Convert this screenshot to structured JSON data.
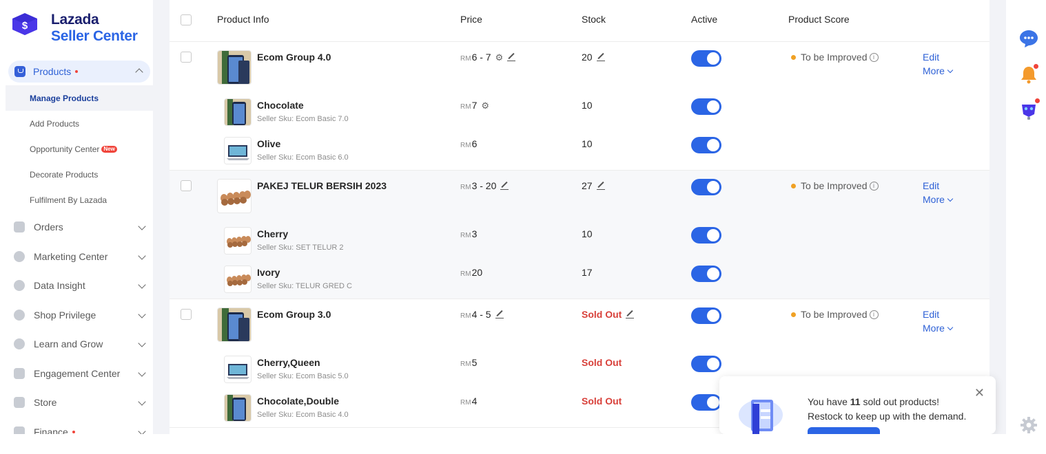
{
  "brand": {
    "line1": "Lazada",
    "line2": "Seller Center"
  },
  "sidebar": {
    "products": {
      "label": "Products"
    },
    "sub_items": [
      "Manage Products",
      "Add Products",
      "Opportunity Center",
      "Decorate Products",
      "Fulfilment By Lazada"
    ],
    "new_badge": "New",
    "items": [
      {
        "label": "Orders"
      },
      {
        "label": "Marketing Center"
      },
      {
        "label": "Data Insight"
      },
      {
        "label": "Shop Privilege"
      },
      {
        "label": "Learn and Grow"
      },
      {
        "label": "Engagement Center"
      },
      {
        "label": "Store"
      },
      {
        "label": "Finance"
      }
    ]
  },
  "table": {
    "headers": {
      "product_info": "Product Info",
      "price": "Price",
      "stock": "Stock",
      "active": "Active",
      "score": "Product Score"
    },
    "currency": "RM",
    "score_label": "To be Improved",
    "edit_label": "Edit",
    "more_label": "More",
    "sold_out_label": "Sold Out",
    "groups": [
      {
        "name": "Ecom Group 4.0",
        "price": "6 - 7",
        "stock": "20",
        "variants": [
          {
            "name": "Chocolate",
            "sku": "Seller Sku: Ecom Basic 7.0",
            "price": "7",
            "stock": "10"
          },
          {
            "name": "Olive",
            "sku": "Seller Sku: Ecom Basic 6.0",
            "price": "6",
            "stock": "10"
          }
        ]
      },
      {
        "name": "PAKEJ TELUR BERSIH 2023",
        "price": "3 - 20",
        "stock": "27",
        "variants": [
          {
            "name": "Cherry",
            "sku": "Seller Sku: SET TELUR 2",
            "price": "3",
            "stock": "10"
          },
          {
            "name": "Ivory",
            "sku": "Seller Sku: TELUR GRED C",
            "price": "20",
            "stock": "17"
          }
        ]
      },
      {
        "name": "Ecom Group 3.0",
        "price": "4 - 5",
        "stock": "Sold Out",
        "variants": [
          {
            "name": "Cherry,Queen",
            "sku": "Seller Sku: Ecom Basic 5.0",
            "price": "5",
            "stock": "Sold Out"
          },
          {
            "name": "Chocolate,Double",
            "sku": "Seller Sku: Ecom Basic 4.0",
            "price": "4",
            "stock": "Sold Out"
          }
        ]
      }
    ]
  },
  "toast": {
    "prefix": "You have ",
    "count": "11",
    "suffix": " sold out products!",
    "line2": "Restock to keep up with the demand."
  },
  "icons": {
    "brand": "lazada-logo-icon",
    "chat": "chat-icon",
    "bell": "bell-icon",
    "assistant": "robot-assistant-icon",
    "settings": "gear-icon"
  },
  "colors": {
    "accent": "#2b65e5",
    "sold_out": "#d8403a",
    "score_dot": "#f0a124",
    "badge": "#f0443a"
  }
}
